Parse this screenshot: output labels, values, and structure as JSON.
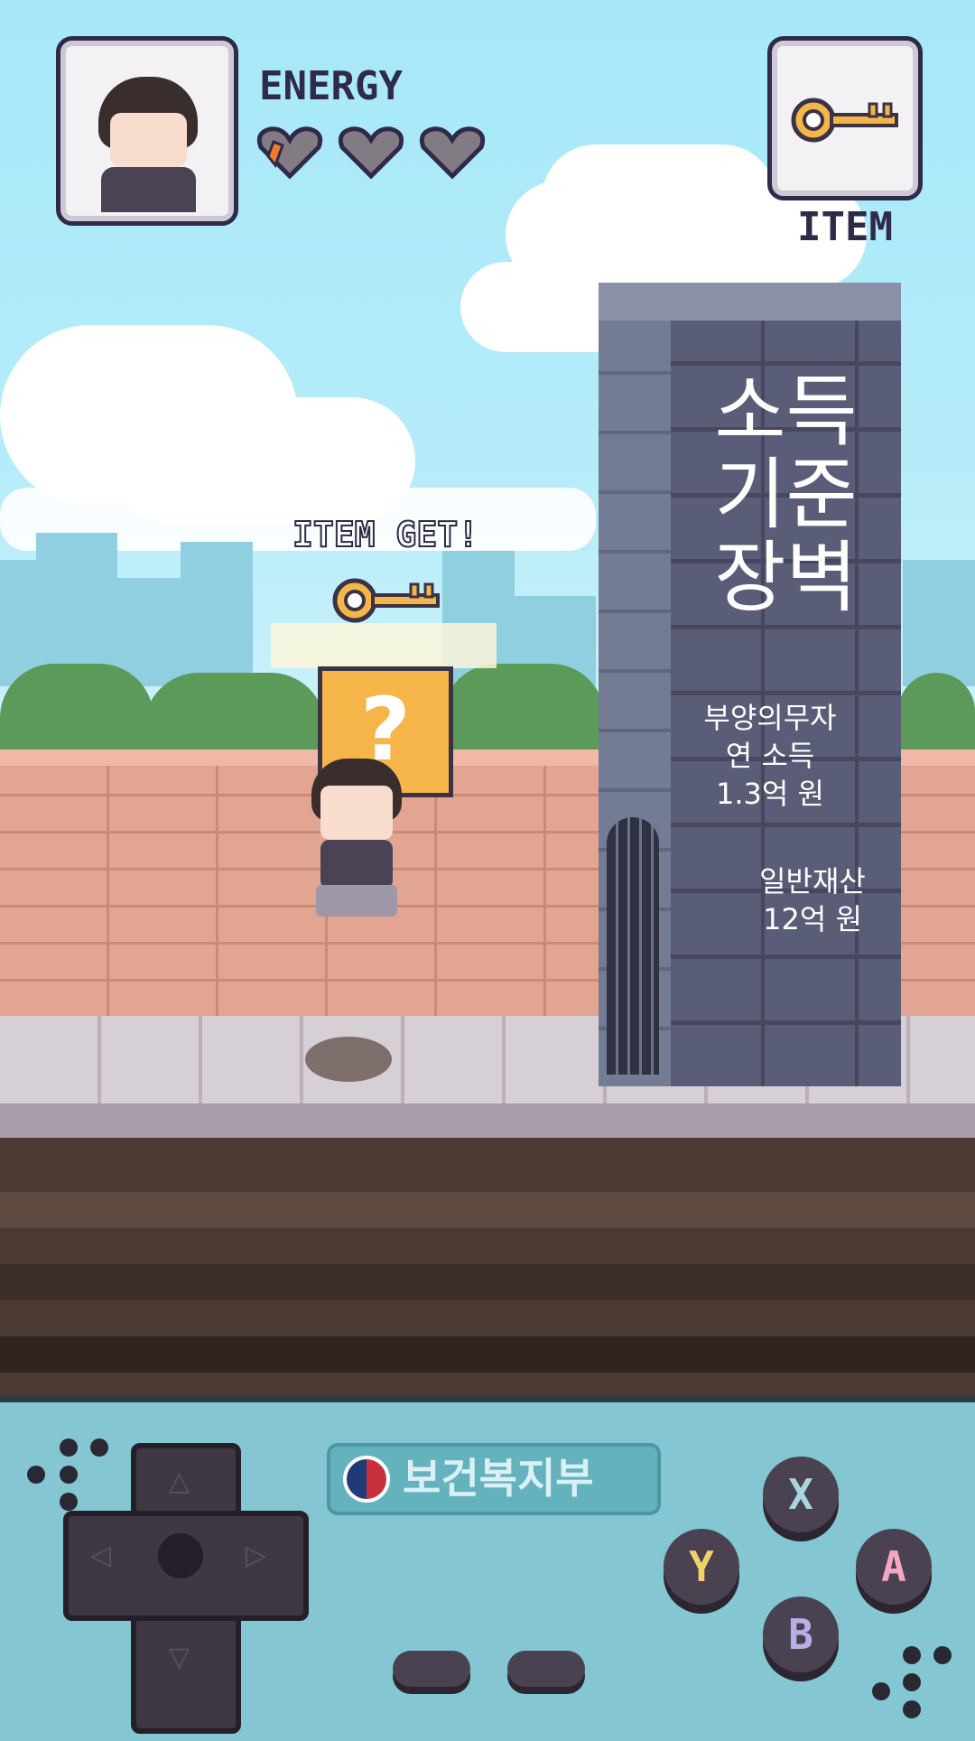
{
  "hud": {
    "energy_label": "ENERGY",
    "hearts_total": 3,
    "hearts_filled": 0,
    "item_label": "ITEM",
    "item_icon": "key-icon"
  },
  "event": {
    "item_get_label": "ITEM GET!",
    "question_mark": "?"
  },
  "tower": {
    "title_lines": [
      "소득",
      "기준",
      "장벽"
    ],
    "line1": "부양의무자",
    "line2": "연 소득",
    "line3": "1.3억 원",
    "line4": "일반재산",
    "line5": "12억 원"
  },
  "controller": {
    "logo_text": "보건복지부",
    "btn_x": "X",
    "btn_y": "Y",
    "btn_a": "A",
    "btn_b": "B"
  },
  "colors": {
    "sky": "#a6e8f8",
    "brick": "#e2a592",
    "tower": "#595d78",
    "controller": "#84c6d2",
    "key": "#f5b549"
  }
}
